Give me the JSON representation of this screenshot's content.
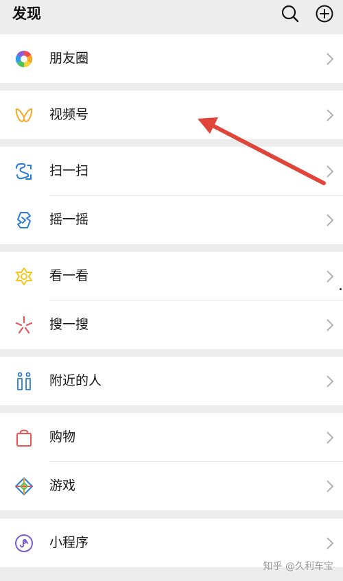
{
  "header": {
    "title": "发现",
    "search_icon": "search-icon",
    "add_icon": "plus-circle-icon"
  },
  "menu": {
    "moments": {
      "label": "朋友圈",
      "icon": "moments-aperture-icon"
    },
    "channels": {
      "label": "视频号",
      "icon": "channels-butterfly-icon"
    },
    "scan": {
      "label": "扫一扫",
      "icon": "scan-icon"
    },
    "shake": {
      "label": "摇一摇",
      "icon": "shake-icon"
    },
    "top_stories": {
      "label": "看一看",
      "icon": "top-stories-icon"
    },
    "search": {
      "label": "搜一搜",
      "icon": "search-sparkle-icon"
    },
    "nearby": {
      "label": "附近的人",
      "icon": "people-nearby-icon"
    },
    "shopping": {
      "label": "购物",
      "icon": "shopping-bag-icon"
    },
    "games": {
      "label": "游戏",
      "icon": "games-diamond-icon"
    },
    "mini_programs": {
      "label": "小程序",
      "icon": "mini-programs-icon"
    }
  },
  "watermark": "知乎 @久利车宝",
  "colors": {
    "background": "#ededed",
    "row_background": "#ffffff",
    "annotation_arrow": "#e0453a",
    "channels_orange": "#f5a623",
    "blue": "#2b7bd6",
    "red": "#e55555"
  }
}
